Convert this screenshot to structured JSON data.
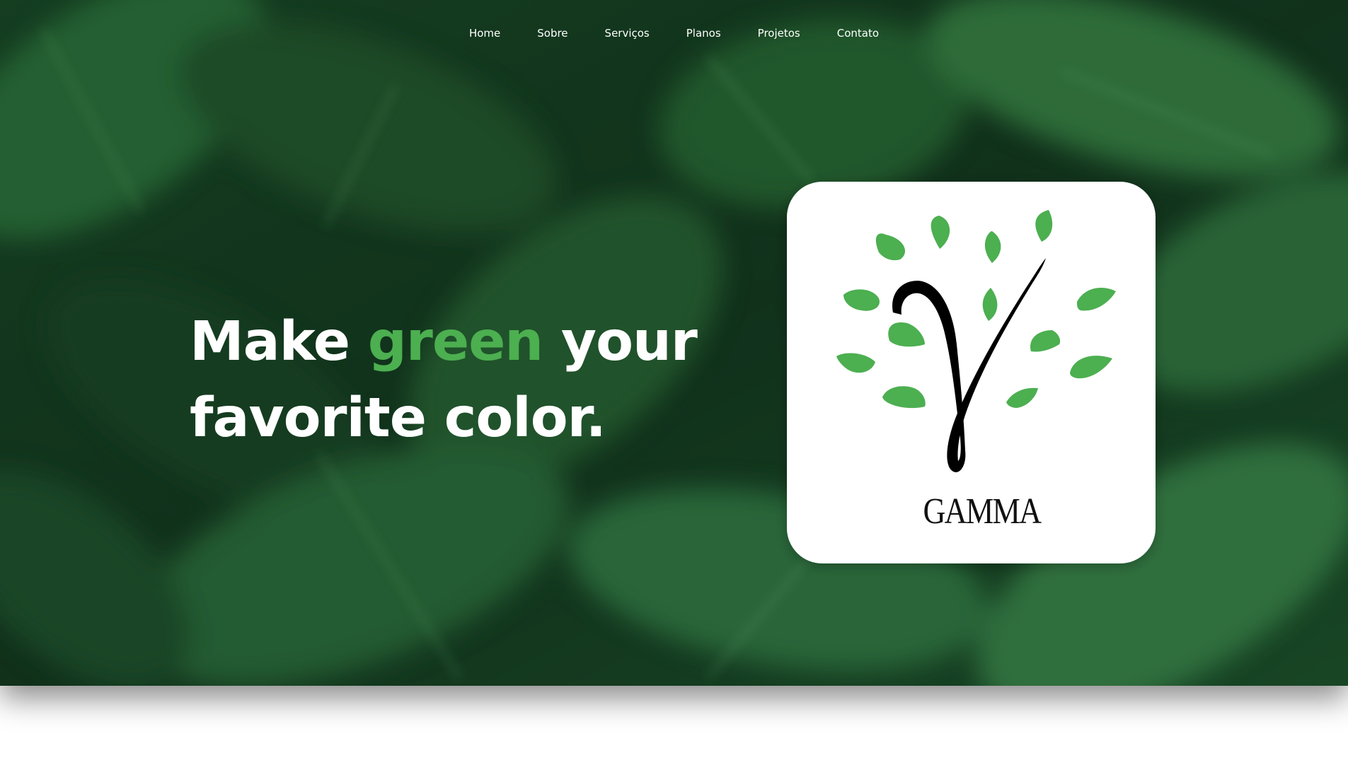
{
  "nav": {
    "items": [
      {
        "label": "Home"
      },
      {
        "label": "Sobre"
      },
      {
        "label": "Serviços"
      },
      {
        "label": "Planos"
      },
      {
        "label": "Projetos"
      },
      {
        "label": "Contato"
      }
    ]
  },
  "hero": {
    "headline_part1": "Make ",
    "headline_accent": "green",
    "headline_part2": " your favorite color.",
    "accent_color": "#4caf50",
    "background_image": "blurred-green-leaves"
  },
  "logo": {
    "brand_text": "GAMMA",
    "leaf_color": "#4caf50",
    "trunk_color": "#000000"
  }
}
